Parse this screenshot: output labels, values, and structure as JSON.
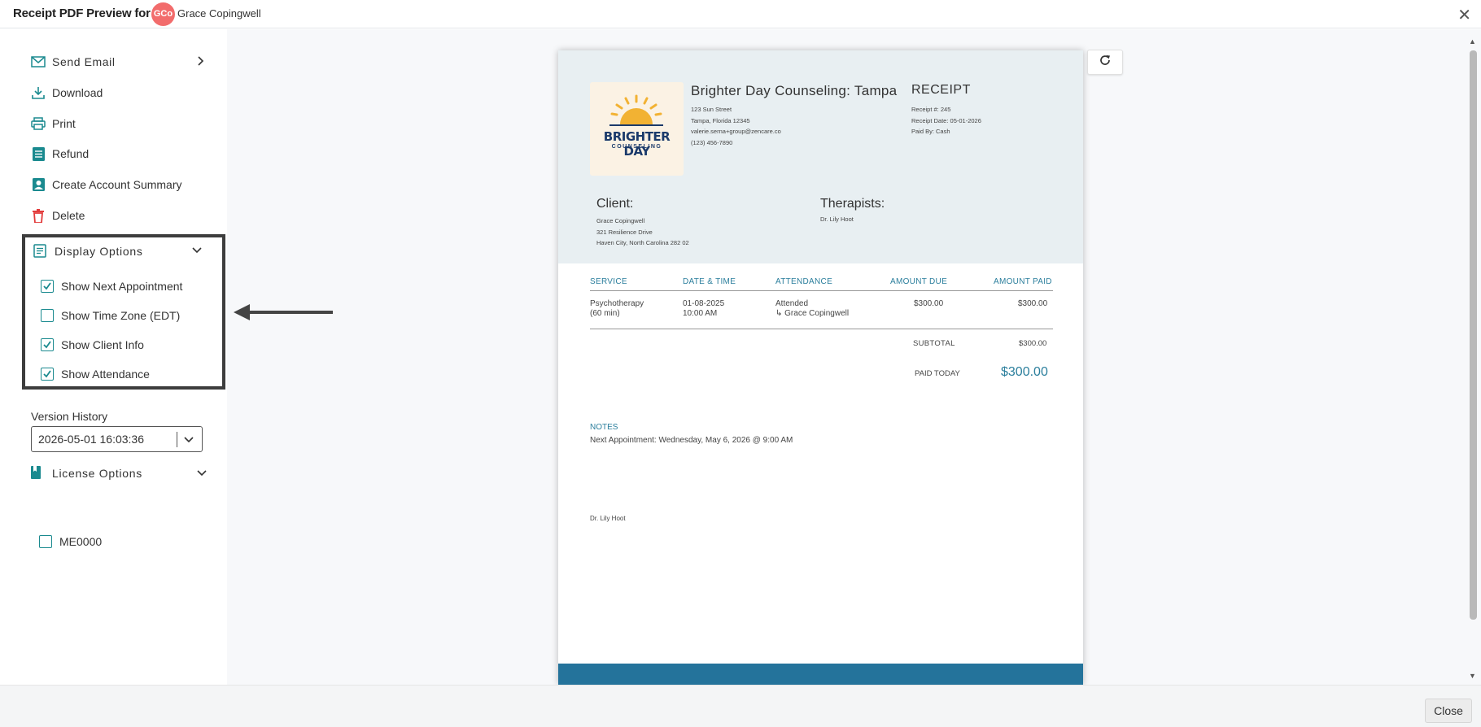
{
  "topbar": {
    "title": "Receipt PDF Preview for",
    "avatar_initials": "GCo",
    "client_name": "Grace Copingwell"
  },
  "sidebar": {
    "send_email": "Send Email",
    "download": "Download",
    "print": "Print",
    "refund": "Refund",
    "create_summary": "Create Account Summary",
    "delete": "Delete",
    "display_options": {
      "label": "Display Options",
      "items": [
        {
          "label": "Show Next Appointment",
          "checked": true
        },
        {
          "label": "Show Time Zone (EDT)",
          "checked": false
        },
        {
          "label": "Show Client Info",
          "checked": true
        },
        {
          "label": "Show Attendance",
          "checked": true
        }
      ]
    },
    "version_history": {
      "label": "Version History",
      "value": "2026-05-01 16:03:36"
    },
    "license_options": {
      "label": "License Options",
      "items": [
        {
          "label": "ME0000",
          "checked": false
        }
      ]
    }
  },
  "receipt": {
    "logo_line1": "BRIGHTER DAY",
    "logo_line2": "COUNSELING",
    "org_name": "Brighter Day Counseling: Tampa",
    "org_address1": "123 Sun Street",
    "org_address2": "Tampa, Florida 12345",
    "org_email": "valerie.serna+group@zencare.co",
    "org_phone": "(123) 456-7890",
    "title": "RECEIPT",
    "receipt_no": "Receipt #: 245",
    "receipt_date": "Receipt Date: 05-01-2026",
    "paid_by": "Paid By: Cash",
    "client_heading": "Client:",
    "client_name": "Grace Copingwell",
    "client_address1": "321 Resilience Drive",
    "client_address2": "Haven City, North Carolina 282 02",
    "therapists_heading": "Therapists:",
    "therapist": "Dr. Lily Hoot",
    "columns": [
      "SERVICE",
      "DATE & TIME",
      "ATTENDANCE",
      "AMOUNT DUE",
      "AMOUNT PAID"
    ],
    "row": {
      "service": "Psychotherapy",
      "duration": "(60 min)",
      "date": "01-08-2025",
      "time": "10:00 AM",
      "attendance": "Attended",
      "attendee": "↳ Grace Copingwell",
      "amount_due": "$300.00",
      "amount_paid": "$300.00"
    },
    "subtotal_label": "SUBTOTAL",
    "subtotal_value": "$300.00",
    "paid_today_label": "PAID TODAY",
    "paid_today_value": "$300.00",
    "notes_heading": "NOTES",
    "notes_text": "Next Appointment: Wednesday, May 6, 2026 @ 9:00 AM",
    "signature": "Dr. Lily Hoot"
  },
  "bottom": {
    "close_label": "Close"
  },
  "colors": {
    "accent": "#1a8a8f",
    "header_bg": "#e8eff2",
    "footer_band": "#24739b",
    "delete_red": "#e23b3b",
    "avatar": "#f26c6c"
  }
}
